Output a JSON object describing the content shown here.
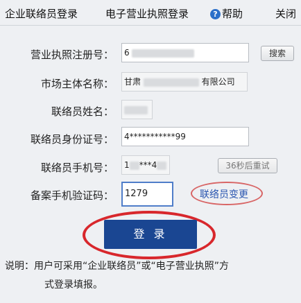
{
  "tabs": {
    "contact_login": "企业联络员登录",
    "license_login": "电子营业执照登录",
    "help": "帮助",
    "close": "关闭"
  },
  "form": {
    "reg_no_label": "营业执照注册号：",
    "reg_no_value": "6",
    "search_button": "搜索",
    "entity_name_label": "市场主体名称：",
    "entity_name_prefix": "甘肃",
    "entity_name_suffix": "有限公司",
    "contact_name_label": "联络员姓名：",
    "contact_id_label": "联络员身份证号：",
    "contact_id_value": "4***********99",
    "contact_phone_label": "联络员手机号：",
    "contact_phone_prefix": "1",
    "contact_phone_mid": "***4",
    "resend_button": "36秒后重试",
    "sms_code_label": "备案手机验证码：",
    "sms_code_value": "1279",
    "change_contact_link": "联络员变更",
    "login_button": "登 录"
  },
  "note": {
    "line1": "说明：用户可采用“企业联络员”或“电子营业执照”方",
    "line2": "式登录填报。"
  },
  "colors": {
    "login_button_bg": "#1a4692",
    "highlight_red": "#d8272c",
    "link_blue": "#2a56b0"
  }
}
